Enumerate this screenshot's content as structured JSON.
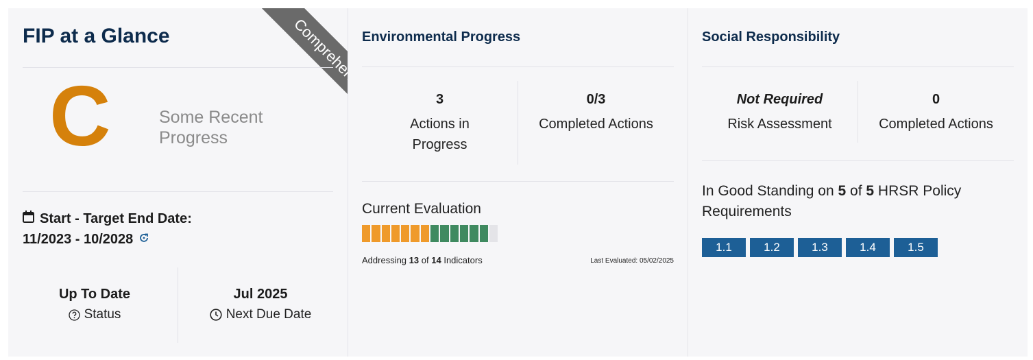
{
  "glance": {
    "title": "FIP at a Glance",
    "ribbon": "Comprehensive",
    "grade": "C",
    "grade_description": "Some Recent Progress",
    "dates_label": "Start - Target End Date:",
    "dates_value": "11/2023 - 10/2028",
    "status_value": "Up To Date",
    "status_label": "Status",
    "due_value": "Jul 2025",
    "due_label": "Next Due Date",
    "calendar_icon": "calendar-icon",
    "refresh_icon": "refresh-icon",
    "help_icon": "question-circle-icon",
    "clock_icon": "clock-icon",
    "grade_color": "#d5810b"
  },
  "environmental": {
    "title": "Environmental Progress",
    "in_progress_value": "3",
    "in_progress_label": "Actions in Progress",
    "completed_value": "0/3",
    "completed_label": "Completed Actions",
    "evaluation_title": "Current Evaluation",
    "addressing_prefix": "Addressing",
    "addressing_count": "13",
    "addressing_of": "of",
    "addressing_total": "14",
    "addressing_suffix": "Indicators",
    "last_evaluated": "Last Evaluated: 05/02/2025",
    "indicator_segments": [
      "orange",
      "orange",
      "orange",
      "orange",
      "orange",
      "orange",
      "orange",
      "green",
      "green",
      "green",
      "green",
      "green",
      "green",
      "empty"
    ],
    "colors": {
      "orange": "#ef9a2b",
      "green": "#3f8a60",
      "empty": "#e4e4e8"
    }
  },
  "social": {
    "title": "Social Responsibility",
    "risk_value": "Not Required",
    "risk_label": "Risk Assessment",
    "completed_value": "0",
    "completed_label": "Completed Actions",
    "standing_prefix": "In Good Standing on",
    "standing_count": "5",
    "standing_of": "of",
    "standing_total": "5",
    "standing_suffix": "HRSR Policy Requirements",
    "requirements": [
      "1.1",
      "1.2",
      "1.3",
      "1.4",
      "1.5"
    ],
    "button_color": "#1d5f96"
  }
}
